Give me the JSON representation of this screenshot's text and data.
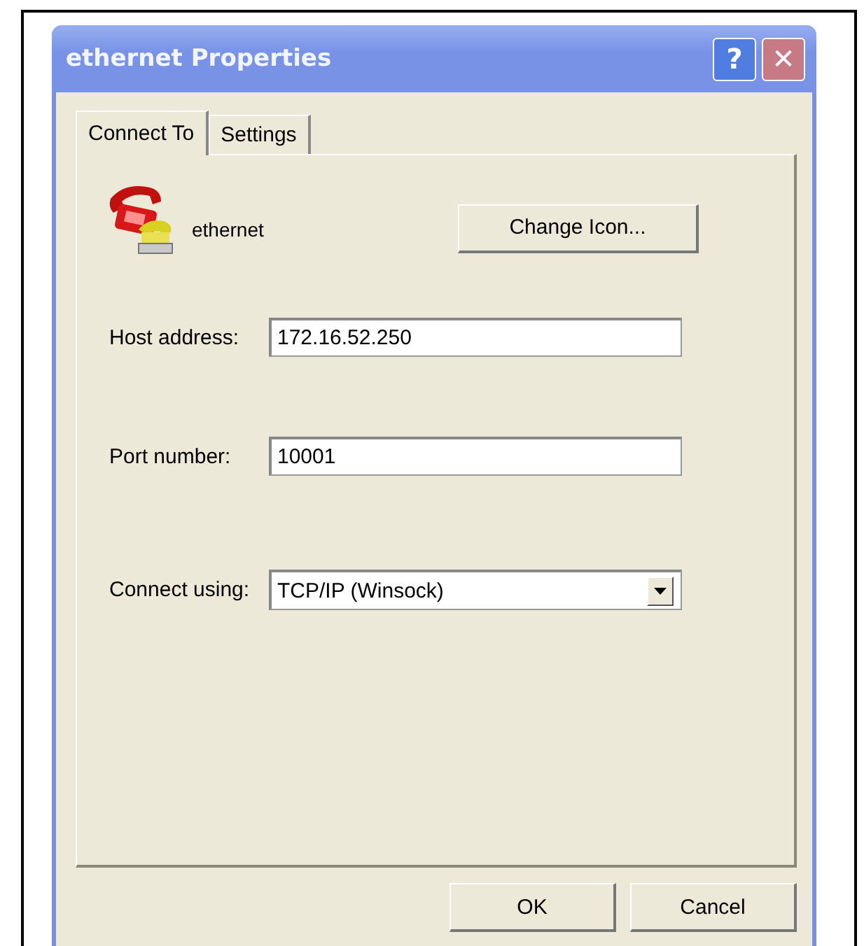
{
  "window": {
    "title": "ethernet Properties"
  },
  "title_buttons": [
    {
      "kind": "help",
      "label": "?"
    },
    {
      "kind": "close",
      "label": "✕"
    }
  ],
  "tabs": [
    {
      "label": "Connect To",
      "selected": true
    },
    {
      "label": "Settings",
      "selected": false
    }
  ],
  "connection": {
    "name": "ethernet",
    "change_icon_button": "Change Icon..."
  },
  "fields": [
    {
      "kind": "text",
      "label": "Host address:",
      "value": "172.16.52.250"
    },
    {
      "kind": "text",
      "label": "Port number:",
      "value": "10001"
    },
    {
      "kind": "select",
      "label": "Connect using:",
      "value": "TCP/IP (Winsock)"
    }
  ],
  "buttons": [
    "OK",
    "Cancel"
  ]
}
